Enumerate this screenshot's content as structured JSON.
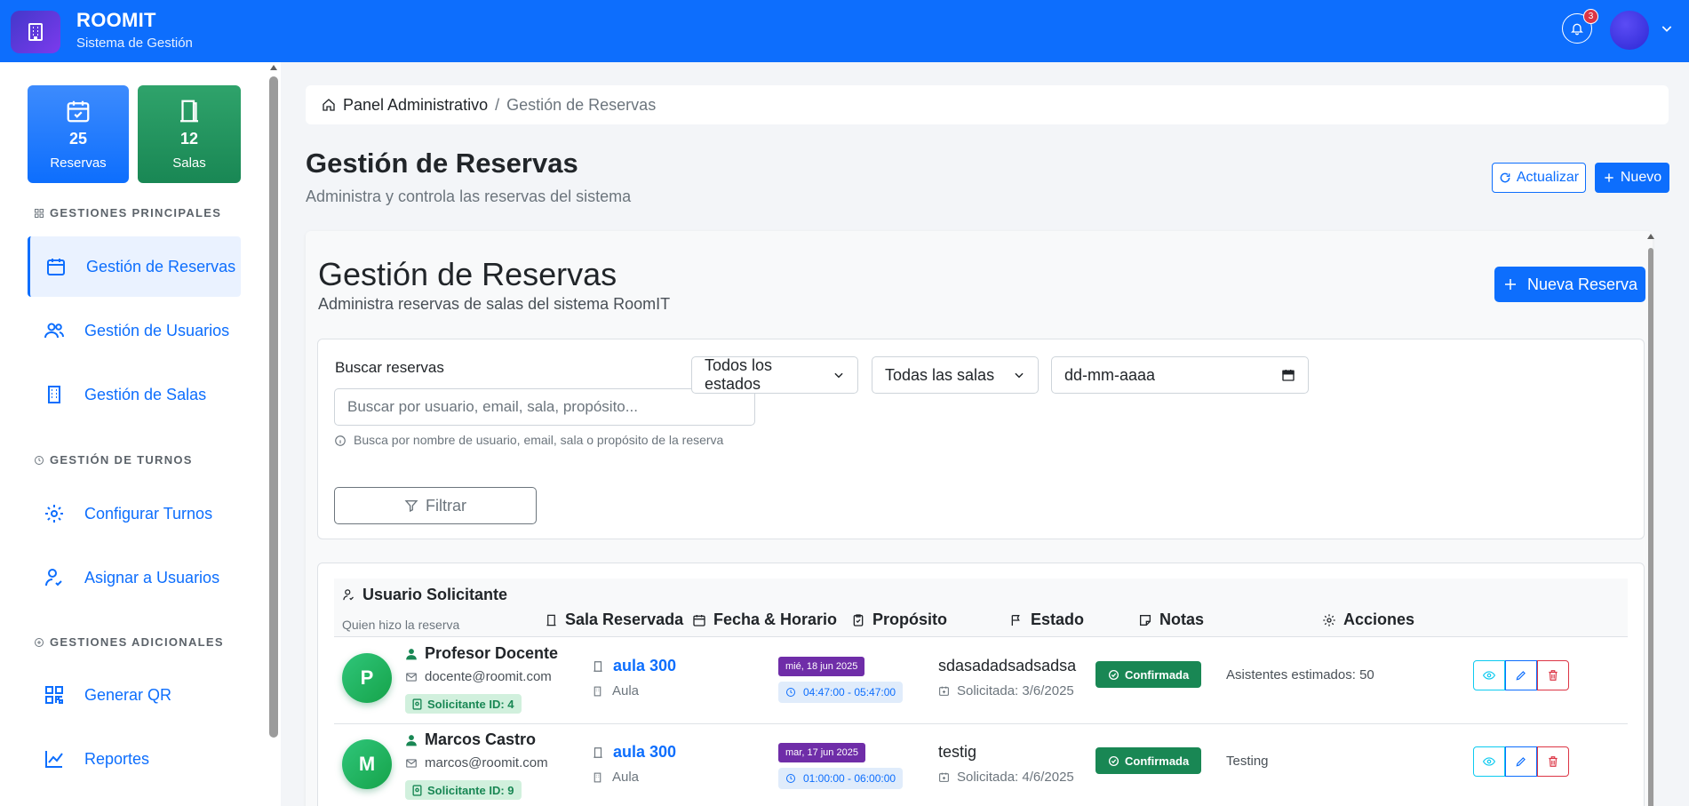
{
  "header": {
    "brand_title": "ROOMIT",
    "brand_subtitle": "Sistema de Gestión",
    "notification_count": "3"
  },
  "sidebar": {
    "stats": [
      {
        "value": "25",
        "label": "Reservas",
        "color": "#0d6efd"
      },
      {
        "value": "12",
        "label": "Salas",
        "color": "#198754"
      }
    ],
    "section_main": "GESTIONES PRINCIPALES",
    "section_turnos": "GESTIÓN DE TURNOS",
    "section_extra": "GESTIONES ADICIONALES",
    "items": [
      {
        "label": "Gestión de Reservas",
        "icon": "calendar-icon",
        "active": true
      },
      {
        "label": "Gestión de Usuarios",
        "icon": "users-icon"
      },
      {
        "label": "Gestión de Salas",
        "icon": "building-icon"
      },
      {
        "label": "Configurar Turnos",
        "icon": "gear-icon"
      },
      {
        "label": "Asignar a Usuarios",
        "icon": "user-check-icon"
      },
      {
        "label": "Generar QR",
        "icon": "qr-code-icon"
      },
      {
        "label": "Reportes",
        "icon": "chart-line-icon"
      }
    ]
  },
  "breadcrumb": {
    "home": "Panel Administrativo",
    "separator": "/",
    "current": "Gestión de Reservas"
  },
  "page": {
    "title": "Gestión de Reservas",
    "subtitle": "Administra y controla las reservas del sistema",
    "refresh_label": "Actualizar",
    "new_label": "Nuevo"
  },
  "card": {
    "title": "Gestión de Reservas",
    "subtitle": "Administra reservas de salas del sistema RoomIT",
    "new_button": "Nueva Reserva"
  },
  "filters": {
    "search_label": "Buscar reservas",
    "search_placeholder": "Buscar por usuario, email, sala, propósito...",
    "search_value": "",
    "search_help": "Busca por nombre de usuario, email, sala o propósito de la reserva",
    "filter_button": "Filtrar",
    "status_select": "Todos los estados",
    "room_select": "Todas las salas",
    "date_input": "dd-mm-aaaa"
  },
  "table": {
    "headers": {
      "usuario": "Usuario Solicitante",
      "usuario_sub": "Quien hizo la reserva",
      "sala": "Sala Reservada",
      "fecha": "Fecha & Horario",
      "proposito": "Propósito",
      "estado": "Estado",
      "notas": "Notas",
      "acciones": "Acciones"
    },
    "rows": [
      {
        "initial": "P",
        "name": "Profesor Docente",
        "email": "docente@roomit.com",
        "id_label": "Solicitante ID: 4",
        "room": "aula 300",
        "room_type": "Aula",
        "date": "mié, 18 jun 2025",
        "time": "04:47:00 - 05:47:00",
        "purpose": "sdasadadsadsadsa",
        "requested": "Solicitada: 3/6/2025",
        "status": "Confirmada",
        "notes": "Asistentes estimados: 50"
      },
      {
        "initial": "M",
        "name": "Marcos Castro",
        "email": "marcos@roomit.com",
        "id_label": "Solicitante ID: 9",
        "room": "aula 300",
        "room_type": "Aula",
        "date": "mar, 17 jun 2025",
        "time": "01:00:00 - 06:00:00",
        "purpose": "testig",
        "requested": "Solicitada: 4/6/2025",
        "status": "Confirmada",
        "notes": "Testing"
      }
    ]
  }
}
